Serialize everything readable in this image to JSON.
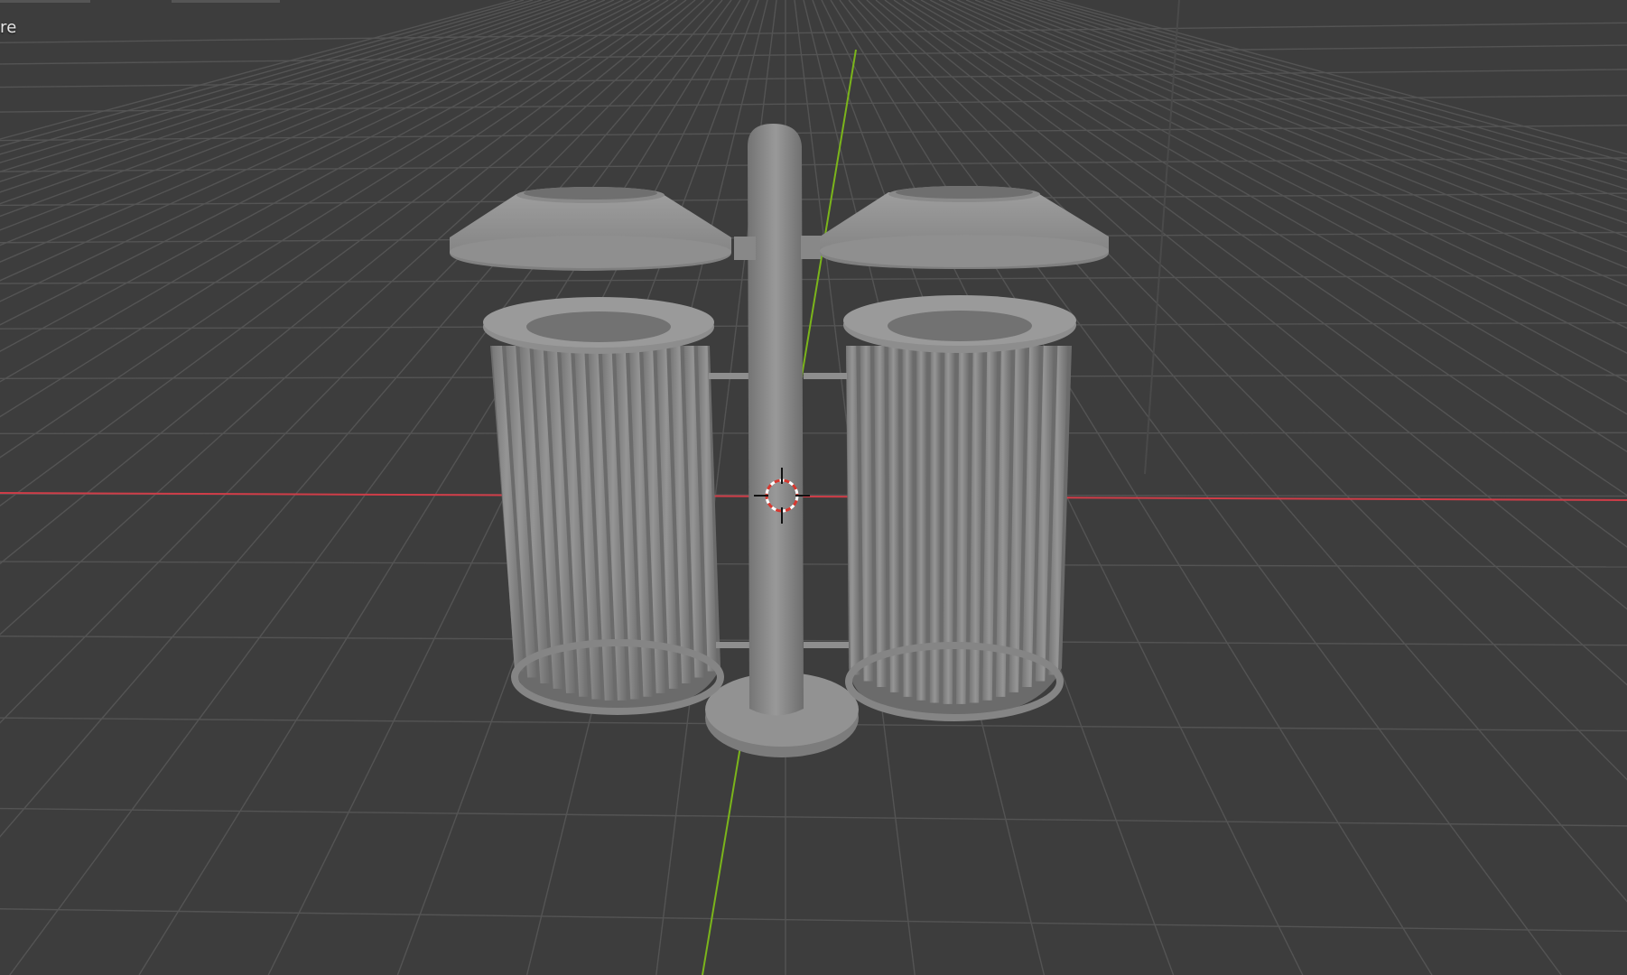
{
  "viewport": {
    "mode_label": "re",
    "background_color": "#3d3d3d",
    "grid_color": "#545454",
    "x_axis_color": "#cf3d48",
    "y_axis_color": "#7bb51b",
    "mesh_color": "#8c8c8c"
  },
  "icons": {
    "cursor": "3d-cursor-icon"
  }
}
